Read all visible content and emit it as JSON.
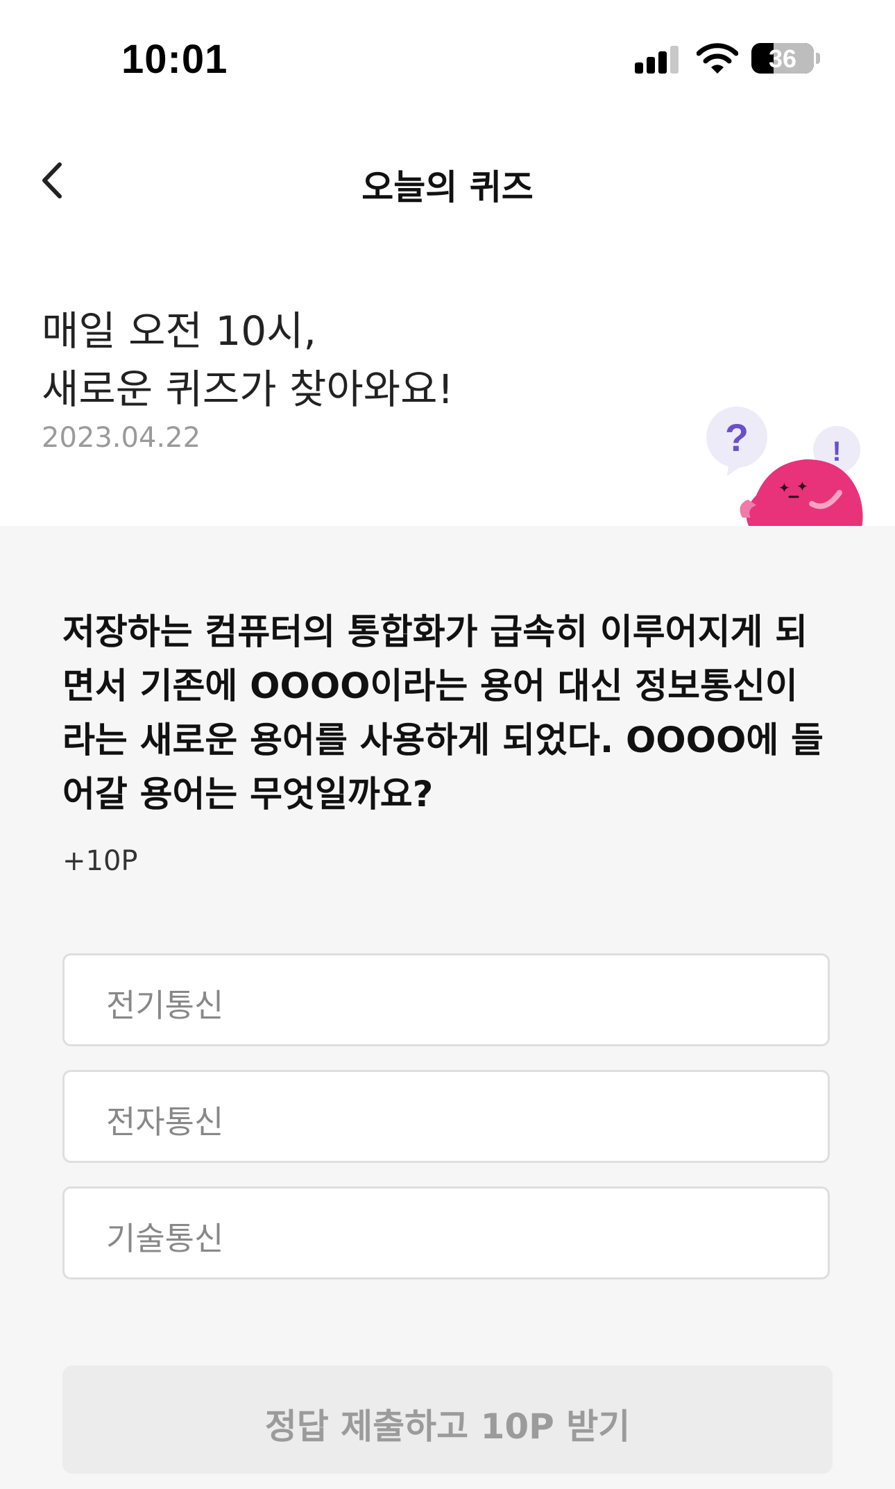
{
  "status_bar": {
    "time": "10:01",
    "battery_percent": "36",
    "icons": [
      "signal-icon",
      "wifi-icon",
      "battery-icon"
    ]
  },
  "nav": {
    "title": "오늘의 퀴즈",
    "back_icon": "chevron-left-icon"
  },
  "header": {
    "headline_line1": "매일 오전 10시,",
    "headline_line2": "새로운 퀴즈가 찾아와요!",
    "date": "2023.04.22",
    "mascot_bubble_left": "?",
    "mascot_bubble_right": "!"
  },
  "quiz": {
    "question_lines": [
      "저장하는 컴퓨터의 통합화가 급속히 이루어지게 되",
      "면서 기존에 OOOO이라는 용어 대신 정보통신이",
      "라는 새로운 용어를 사용하게 되었다. OOOO에 들",
      "어갈 용어는 무엇일까요?"
    ],
    "points": "+10P",
    "options": [
      {
        "label": "전기통신"
      },
      {
        "label": "전자통신"
      },
      {
        "label": "기술통신"
      }
    ],
    "submit_label": "정답 제출하고 10P 받기"
  },
  "colors": {
    "content_bg": "#f6f6f6",
    "mascot_pink": "#e8327a",
    "bubble_purple": "#6b4fc8",
    "button_disabled_bg": "#ececec",
    "button_disabled_text": "#9b9b9b"
  }
}
